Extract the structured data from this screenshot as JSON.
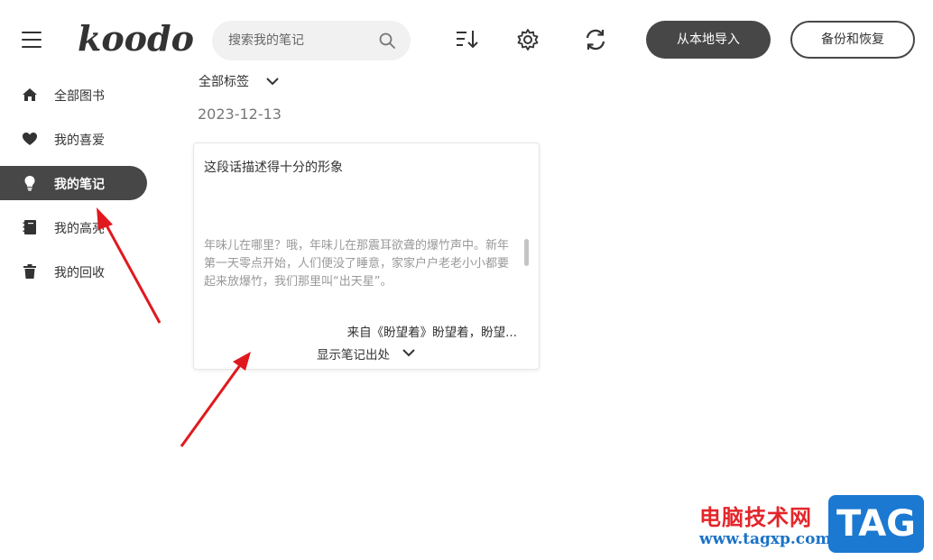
{
  "header": {
    "logo": "koodo",
    "search_placeholder": "搜索我的笔记",
    "import_button": "从本地导入",
    "backup_button": "备份和恢复"
  },
  "sidebar": {
    "items": [
      {
        "label": "全部图书",
        "icon": "home-icon"
      },
      {
        "label": "我的喜爱",
        "icon": "heart-icon"
      },
      {
        "label": "我的笔记",
        "icon": "lightbulb-icon",
        "active": true
      },
      {
        "label": "我的高亮",
        "icon": "notebook-icon"
      },
      {
        "label": "我的回收",
        "icon": "trash-icon"
      }
    ]
  },
  "content": {
    "tag_filter": "全部标签",
    "date": "2023-12-13",
    "card": {
      "note": "这段话描述得十分的形象",
      "excerpt": "年味儿在哪里？哦，年味儿在那震耳欲聋的爆竹声中。新年第一天零点开始，人们便没了睡意，家家户户老老小小都要起来放爆竹，我们那里叫“出天星”。",
      "source": "来自《盼望着》盼望着，盼望...",
      "show_source": "显示笔记出处"
    }
  },
  "watermark": {
    "text": "电脑技术网",
    "url": "www.tagxp.com",
    "badge": "TAG"
  },
  "colors": {
    "active_bg": "#474747",
    "arrow": "#e0191e"
  }
}
